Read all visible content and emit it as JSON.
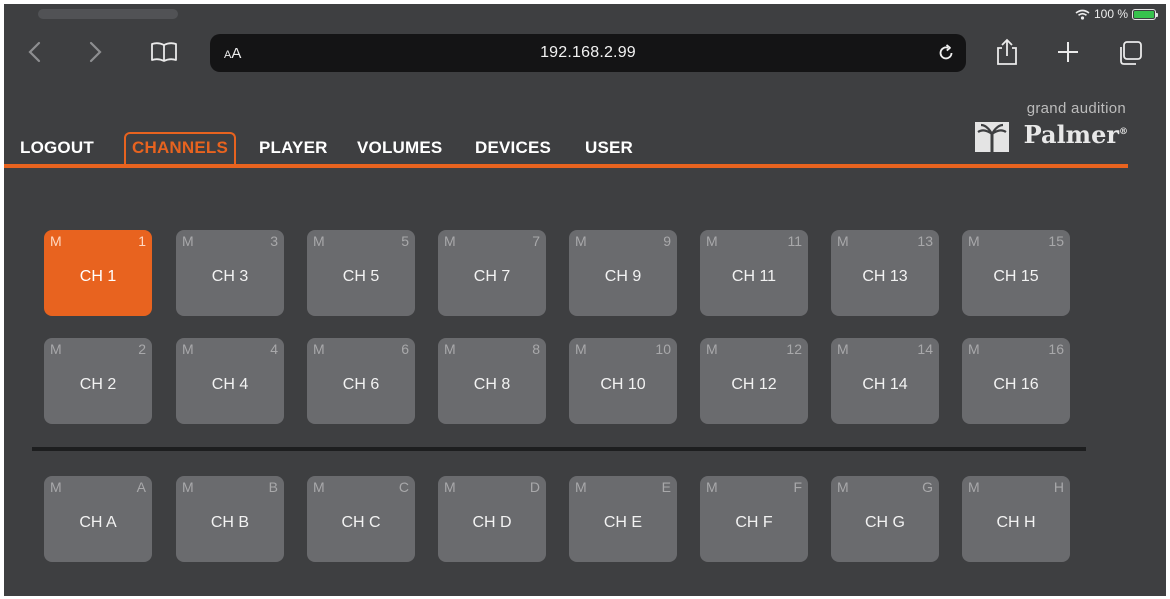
{
  "status_bar": {
    "battery_text": "100 %",
    "battery_level": 1.0
  },
  "browser": {
    "reader_label": "AA",
    "url": "192.168.2.99",
    "icons": [
      "back-icon",
      "forward-icon",
      "bookmarks-icon",
      "reload-icon",
      "share-icon",
      "new-tab-icon",
      "tabs-icon"
    ]
  },
  "brand": {
    "tagline": "grand audition",
    "name": "Palmer",
    "mark": "®"
  },
  "menu": [
    {
      "label": "LOGOUT",
      "active": false
    },
    {
      "label": "CHANNELS",
      "active": true
    },
    {
      "label": "PLAYER",
      "active": false
    },
    {
      "label": "VOLUMES",
      "active": false
    },
    {
      "label": "DEVICES",
      "active": false
    },
    {
      "label": "USER",
      "active": false
    }
  ],
  "colors": {
    "accent": "#e8631f",
    "button": "#6a6b6e",
    "background": "#3e3f41"
  },
  "channels": {
    "mute_label": "M",
    "row1": [
      {
        "id": "1",
        "label": "CH 1",
        "active": true
      },
      {
        "id": "3",
        "label": "CH 3",
        "active": false
      },
      {
        "id": "5",
        "label": "CH 5",
        "active": false
      },
      {
        "id": "7",
        "label": "CH 7",
        "active": false
      },
      {
        "id": "9",
        "label": "CH 9",
        "active": false
      },
      {
        "id": "11",
        "label": "CH 11",
        "active": false
      },
      {
        "id": "13",
        "label": "CH 13",
        "active": false
      },
      {
        "id": "15",
        "label": "CH 15",
        "active": false
      }
    ],
    "row2": [
      {
        "id": "2",
        "label": "CH 2",
        "active": false
      },
      {
        "id": "4",
        "label": "CH 4",
        "active": false
      },
      {
        "id": "6",
        "label": "CH 6",
        "active": false
      },
      {
        "id": "8",
        "label": "CH 8",
        "active": false
      },
      {
        "id": "10",
        "label": "CH 10",
        "active": false
      },
      {
        "id": "12",
        "label": "CH 12",
        "active": false
      },
      {
        "id": "14",
        "label": "CH 14",
        "active": false
      },
      {
        "id": "16",
        "label": "CH 16",
        "active": false
      }
    ],
    "row3": [
      {
        "id": "A",
        "label": "CH A",
        "active": false
      },
      {
        "id": "B",
        "label": "CH B",
        "active": false
      },
      {
        "id": "C",
        "label": "CH C",
        "active": false
      },
      {
        "id": "D",
        "label": "CH D",
        "active": false
      },
      {
        "id": "E",
        "label": "CH E",
        "active": false
      },
      {
        "id": "F",
        "label": "CH F",
        "active": false
      },
      {
        "id": "G",
        "label": "CH G",
        "active": false
      },
      {
        "id": "H",
        "label": "CH H",
        "active": false
      }
    ]
  }
}
